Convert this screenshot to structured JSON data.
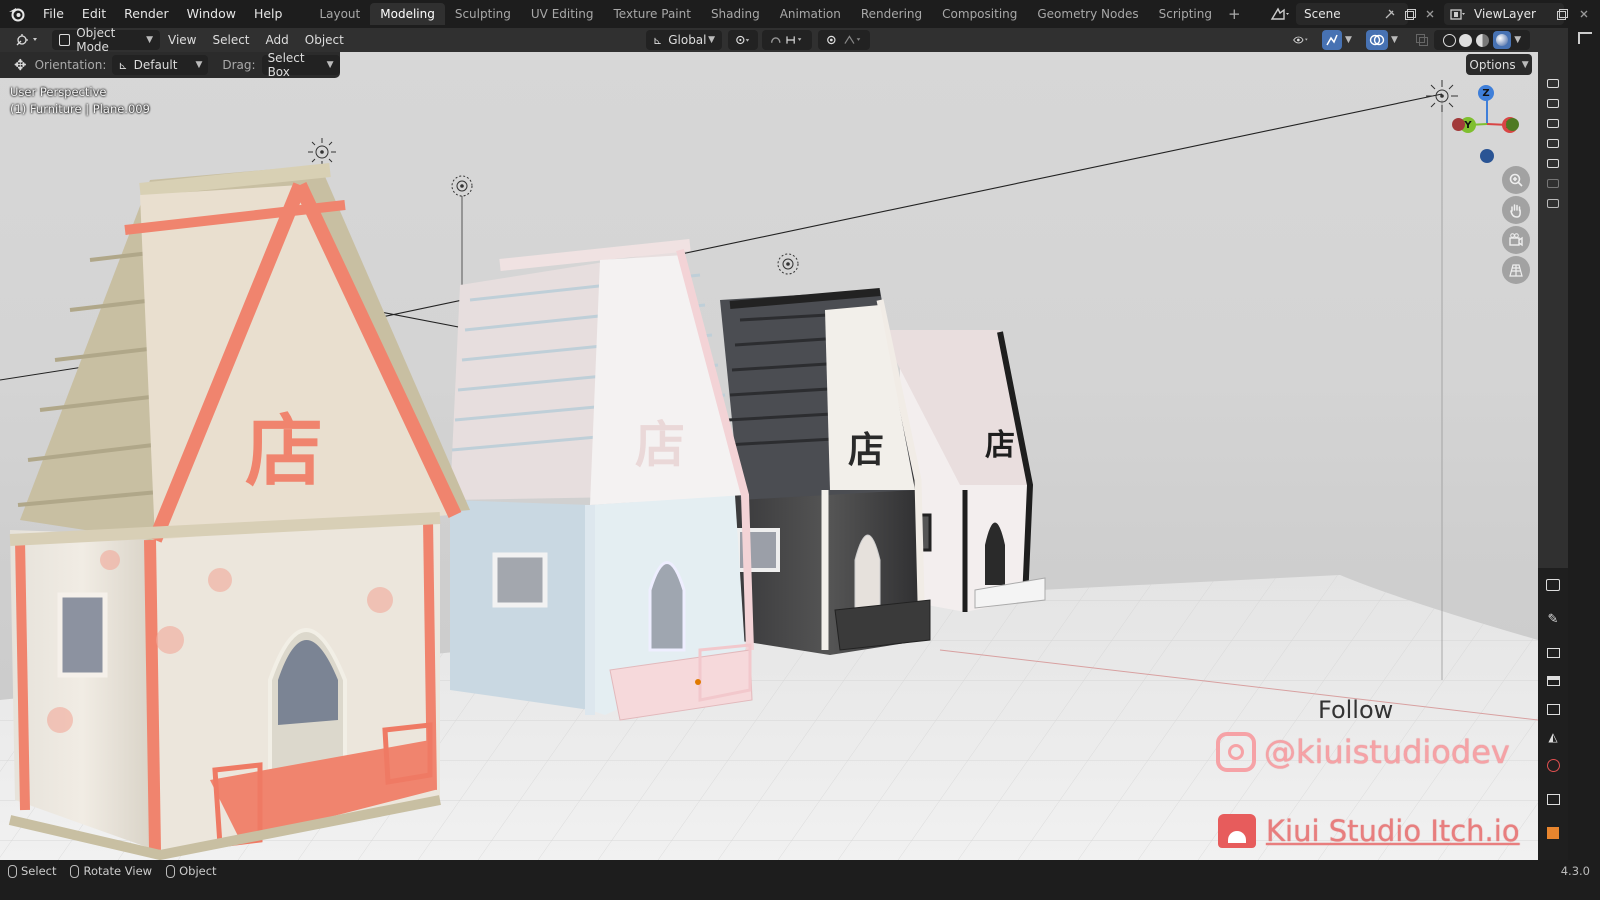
{
  "menu": [
    "File",
    "Edit",
    "Render",
    "Window",
    "Help"
  ],
  "workspaces": {
    "tabs": [
      "Layout",
      "Modeling",
      "Sculpting",
      "UV Editing",
      "Texture Paint",
      "Shading",
      "Animation",
      "Rendering",
      "Compositing",
      "Geometry Nodes",
      "Scripting"
    ],
    "active": "Modeling",
    "add_label": "+"
  },
  "scene": {
    "name": "Scene",
    "view_layer": "ViewLayer"
  },
  "viewport_header": {
    "mode": "Object Mode",
    "menus": [
      "View",
      "Select",
      "Add",
      "Object"
    ],
    "transform_orientation": "Global"
  },
  "tool_settings": {
    "orientation_label": "Orientation:",
    "orientation_value": "Default",
    "drag_label": "Drag:",
    "drag_value": "Select Box",
    "options_label": "Options"
  },
  "viewport": {
    "perspective": "User Perspective",
    "active_object": "(1) Furniture | Plane.009",
    "gizmo_axes": {
      "z": "Z",
      "y": "Y",
      "x": "X"
    }
  },
  "overlay": {
    "follow": "Follow",
    "instagram": "@kiuistudiodev",
    "itch": "Kiui Studio Itch.io",
    "sign_char": "店"
  },
  "status_bar": {
    "items": [
      "Select",
      "Rotate View",
      "Object"
    ],
    "version": "4.3.0"
  },
  "colors": {
    "ui_dark": "#1d1d1d",
    "header": "#303030",
    "active_tab": "#303030",
    "accent_blue": "#4772b3",
    "pink_text": "#f6a2a6",
    "coral_trim": "#f0846e",
    "axis_x": "#d94545",
    "axis_y": "#7fbf2f",
    "axis_z": "#3f7fd9"
  },
  "icons": [
    "blender-logo",
    "scene-icon",
    "pin-icon",
    "view-layer-icon",
    "editor-type-icon",
    "object-mode-icon",
    "orientation-icon",
    "pivot-icon",
    "snap-icon",
    "proportional-icon",
    "visibility-icon",
    "gizmo-icon",
    "overlay-icon",
    "xray-icon",
    "shading-wire-icon",
    "shading-solid-icon",
    "shading-material-icon",
    "shading-rendered-icon",
    "zoom-icon",
    "pan-hand-icon",
    "camera-view-icon",
    "ortho-grid-icon",
    "instagram-icon",
    "itch-icon",
    "outliner-icon"
  ]
}
